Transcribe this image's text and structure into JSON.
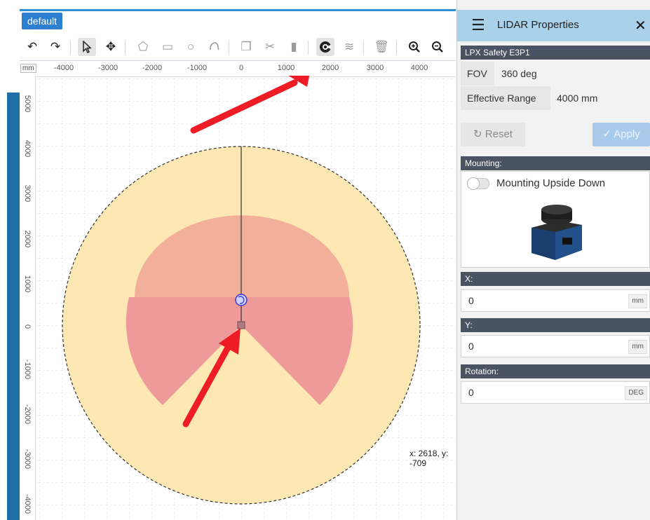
{
  "tab": {
    "label": "default"
  },
  "toolbar": {
    "icons": [
      "undo-icon",
      "redo-icon",
      "select-icon",
      "move-icon",
      "polygon-icon",
      "rectangle-icon",
      "circle-icon",
      "freeform-icon",
      "duplicate-icon",
      "cut-icon",
      "paste-icon",
      "lidar-icon",
      "layers-icon",
      "delete-icon",
      "zoom-in-icon",
      "zoom-out-icon"
    ]
  },
  "ruler": {
    "unit": "mm",
    "x_ticks": [
      "-4000",
      "-3000",
      "-2000",
      "-1000",
      "0",
      "1000",
      "2000",
      "3000",
      "4000"
    ],
    "y_ticks": [
      "5000",
      "4000",
      "3000",
      "2000",
      "1000",
      "0",
      "-1000",
      "-2000",
      "-3000",
      "-4000"
    ]
  },
  "canvas": {
    "cursor_readout": "x: 2618, y: -709",
    "colors": {
      "range_fill": "#fde7b3",
      "field_fill": "#ef9a9a",
      "arrow": "#ee1c25"
    }
  },
  "panel": {
    "title": "LIDAR Properties",
    "device_name": "LPX Safety E3P1",
    "fov_label": "FOV",
    "fov_value": "360 deg",
    "range_label": "Effective Range",
    "range_value": "4000 mm",
    "reset_label": "Reset",
    "apply_label": "Apply",
    "mounting_label": "Mounting:",
    "upside_down_label": "Mounting Upside Down",
    "x_label": "X:",
    "x_value": "0",
    "x_unit": "mm",
    "y_label": "Y:",
    "y_value": "0",
    "y_unit": "mm",
    "rotation_label": "Rotation:",
    "rotation_value": "0",
    "rotation_unit": "DEG"
  }
}
